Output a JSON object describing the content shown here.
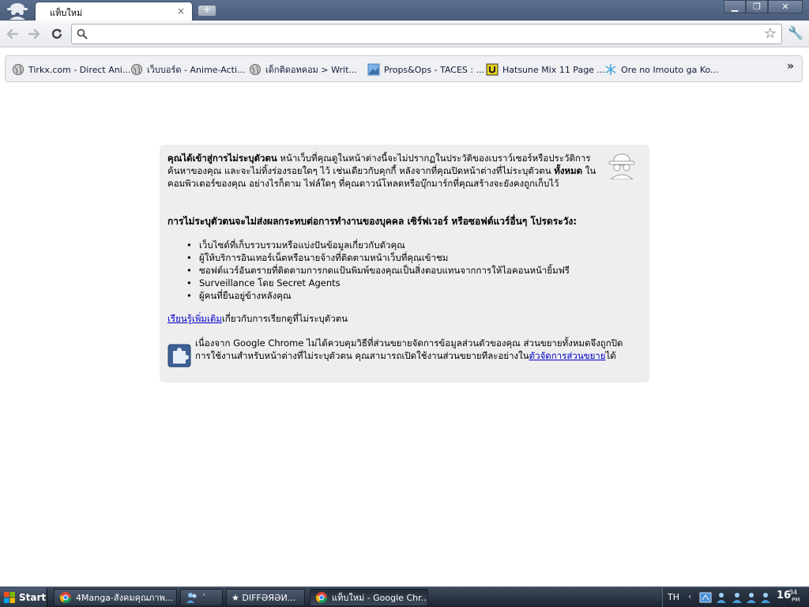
{
  "window": {
    "tab_title": "แท็บใหม่",
    "tab_close": "×",
    "new_tab": "+",
    "minimize": "▁",
    "maximize": "❐",
    "close": "✕"
  },
  "toolbar": {
    "omnibox_value": "",
    "back_icon": "back-arrow-icon",
    "forward_icon": "forward-arrow-icon",
    "reload_icon": "reload-icon"
  },
  "bookmarks": {
    "items": [
      {
        "label": "Tirkx.com - Direct Ani...",
        "icon": "globe-icon"
      },
      {
        "label": "เว็บบอร์ด - Anime-Acti...",
        "icon": "globe-icon"
      },
      {
        "label": "เด็กติดอทคอม > Writ...",
        "icon": "globe-icon"
      },
      {
        "label": "Props&Ops - TACES : ...",
        "icon": "image-icon"
      },
      {
        "label": "Hatsune Mix 11 Page ...",
        "icon": "u-logo-icon"
      },
      {
        "label": "Ore no Imouto ga Ko...",
        "icon": "snowflake-icon"
      }
    ],
    "more": "»"
  },
  "incognito": {
    "p1_bold": "คุณได้เข้าสู่การไม่ระบุตัวตน",
    "p1_text_a": " หน้าเว็บที่คุณดูในหน้าต่างนี้จะไม่ปรากฏในประวัติของเบราว์เซอร์หรือประวัติการค้นหาของคุณ และจะไม่ทิ้งร่องรอยใดๆ ไว้ เช่นเดียวกับคุกกี้ หลังจากที่คุณปิดหน้าต่างที่ไม่ระบุตัวตน ",
    "p1_bold2": "ทั้งหมด",
    "p1_text_b": " ในคอมพิวเตอร์ของคุณ อย่างไรก็ตาม ไฟล์ใดๆ ที่คุณดาวน์โหลดหรือบุ๊กมาร์กที่คุณสร้างจะยังคงถูกเก็บไว้",
    "p2": "การไม่ระบุตัวตนจะไม่ส่งผลกระทบต่อการทำงานของบุคคล เซิร์ฟเวอร์ หรือซอฟต์แวร์อื่นๆ โปรดระวัง:",
    "bullets": [
      "เว็บไซต์ที่เก็บรวบรวมหรือแบ่งปันข้อมูลเกี่ยวกับตัวคุณ",
      "ผู้ให้บริการอินเทอร์เน็ตหรือนายจ้างที่ติดตามหน้าเว็บที่คุณเข้าชม",
      "ซอฟต์แวร์อันตรายที่ติดตามการกดแป้นพิมพ์ของคุณเป็นสิ่งตอบแทนจากการให้ไอคอนหน้ายิ้มฟรี",
      "Surveillance โดย Secret Agents",
      "ผู้คนที่ยืนอยู่ข้างหลังคุณ"
    ],
    "learn_link": "เรียนรู้เพิ่มเติม",
    "learn_rest": "เกี่ยวกับการเรียกดูที่ไม่ระบุตัวตน",
    "ext_text": "เนื่องจาก Google Chrome ไม่ได้ควบคุมวิธีที่ส่วนขยายจัดการข้อมูลส่วนตัวของคุณ ส่วนขยายทั้งหมดจึงถูกปิดการใช้งานสำหรับหน้าต่างที่ไม่ระบุตัวตน คุณสามารถเปิดใช้งานส่วนขยายทีละอย่างใน",
    "ext_link": "ตัวจัดการส่วนขยาย",
    "ext_end": "ได้"
  },
  "taskbar": {
    "start": "Start",
    "items": [
      {
        "label": "4Manga-สังคมคุณภาพ...",
        "icon": "chrome-icon"
      },
      {
        "label": "` ",
        "icon": "people-icon"
      },
      {
        "label": "★ DIFFƏЯƏИ...",
        "icon": "none"
      },
      {
        "label": "แท็บใหม่ - Google Chr...",
        "icon": "chrome-icon"
      }
    ],
    "lang": "TH",
    "tray_arrow": "‹",
    "clock_hour": "16",
    "clock_min": "34",
    "clock_ampm": "PM"
  }
}
